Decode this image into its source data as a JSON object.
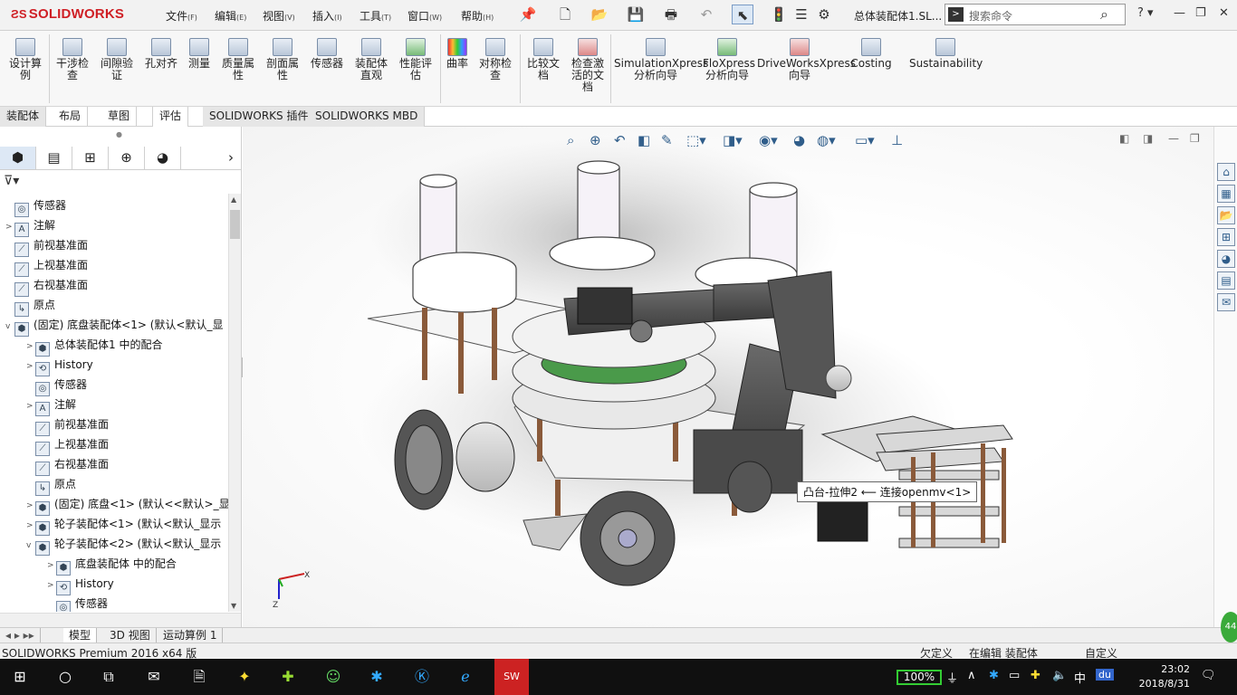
{
  "app": {
    "logo": "SOLIDWORKS",
    "doc_title": "总体装配体1.SL..."
  },
  "menu": [
    {
      "label": "文件",
      "key": "(F)"
    },
    {
      "label": "编辑",
      "key": "(E)"
    },
    {
      "label": "视图",
      "key": "(V)"
    },
    {
      "label": "插入",
      "key": "(I)"
    },
    {
      "label": "工具",
      "key": "(T)"
    },
    {
      "label": "窗口",
      "key": "(W)"
    },
    {
      "label": "帮助",
      "key": "(H)"
    }
  ],
  "search": {
    "placeholder": "搜索命令"
  },
  "ribbon": [
    "设计算例",
    "干涉检查",
    "间隙验证",
    "孔对齐",
    "测量",
    "质量属性",
    "剖面属性",
    "传感器",
    "装配体直观",
    "性能评估",
    "曲率",
    "对称检查",
    "比较文档",
    "检查激活的文档",
    "SimulationXpress分析向导",
    "FloXpress分析向导",
    "DriveWorksXpress向导",
    "Costing",
    "Sustainability"
  ],
  "tabs": [
    "装配体",
    "布局",
    "草图",
    "评估",
    "SOLIDWORKS 插件",
    "SOLIDWORKS MBD"
  ],
  "tree": [
    {
      "label": "传感器",
      "indent": 0,
      "exp": ""
    },
    {
      "label": "注解",
      "indent": 0,
      "exp": ">"
    },
    {
      "label": "前视基准面",
      "indent": 0,
      "exp": ""
    },
    {
      "label": "上视基准面",
      "indent": 0,
      "exp": ""
    },
    {
      "label": "右视基准面",
      "indent": 0,
      "exp": ""
    },
    {
      "label": "原点",
      "indent": 0,
      "exp": ""
    },
    {
      "label": "(固定) 底盘装配体<1> (默认<默认_显",
      "indent": 0,
      "exp": "v"
    },
    {
      "label": "总体装配体1 中的配合",
      "indent": 1,
      "exp": ">"
    },
    {
      "label": "History",
      "indent": 1,
      "exp": ">"
    },
    {
      "label": "传感器",
      "indent": 1,
      "exp": ""
    },
    {
      "label": "注解",
      "indent": 1,
      "exp": ">"
    },
    {
      "label": "前视基准面",
      "indent": 1,
      "exp": ""
    },
    {
      "label": "上视基准面",
      "indent": 1,
      "exp": ""
    },
    {
      "label": "右视基准面",
      "indent": 1,
      "exp": ""
    },
    {
      "label": "原点",
      "indent": 1,
      "exp": ""
    },
    {
      "label": "(固定) 底盘<1> (默认<<默认>_显",
      "indent": 1,
      "exp": ">"
    },
    {
      "label": "轮子装配体<1> (默认<默认_显示",
      "indent": 1,
      "exp": ">"
    },
    {
      "label": "轮子装配体<2> (默认<默认_显示",
      "indent": 1,
      "exp": "v"
    },
    {
      "label": "底盘装配体 中的配合",
      "indent": 2,
      "exp": ">"
    },
    {
      "label": "History",
      "indent": 2,
      "exp": ">"
    },
    {
      "label": "传感器",
      "indent": 2,
      "exp": ""
    }
  ],
  "viewport": {
    "tooltip": "凸台-拉伸2 ⟵ 连接openmv<1>"
  },
  "bottom_tabs": [
    "模型",
    "3D 视图",
    "运动算例 1"
  ],
  "status": {
    "left": "SOLIDWORKS Premium 2016 x64 版",
    "undefined": "欠定义",
    "editing": "在编辑 装配体",
    "custom": "自定义"
  },
  "taskbar": {
    "battery": "100%",
    "ime": "中",
    "time": "23:02",
    "date": "2018/8/31",
    "badge": "44"
  }
}
